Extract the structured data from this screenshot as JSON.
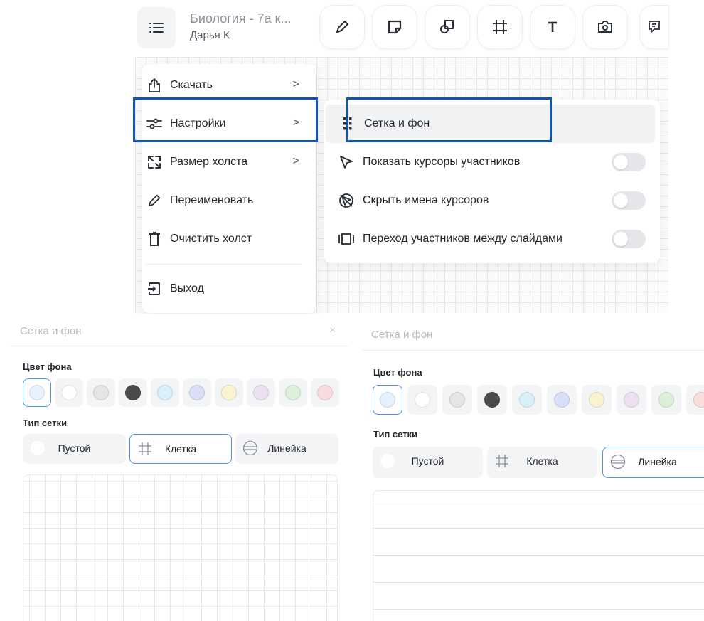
{
  "toolbar": {
    "board_title": "Биология - 7а к...",
    "board_owner": "Дарья К",
    "tools": [
      "pencil-icon",
      "sticky-note-icon",
      "shapes-icon",
      "frame-icon",
      "text-icon",
      "camera-icon",
      "comment-icon"
    ]
  },
  "main_menu": {
    "items": [
      {
        "label": "Скачать",
        "icon": "upload-icon",
        "submenu": true
      },
      {
        "label": "Настройки",
        "icon": "sliders-icon",
        "submenu": true
      },
      {
        "label": "Размер холста",
        "icon": "resize-icon",
        "submenu": true
      },
      {
        "label": "Переименовать",
        "icon": "pencil-icon",
        "submenu": false
      },
      {
        "label": "Очистить холст",
        "icon": "trash-icon",
        "submenu": false
      },
      {
        "label": "Выход",
        "icon": "exit-icon",
        "submenu": false
      }
    ],
    "chevron": ">"
  },
  "settings_submenu": {
    "items": [
      {
        "label": "Сетка и фон",
        "icon": "grid-dots-icon",
        "toggle": null
      },
      {
        "label": "Показать курсоры участников",
        "icon": "cursor-icon",
        "toggle": false
      },
      {
        "label": "Скрыть имена курсоров",
        "icon": "hide-names-icon",
        "toggle": false
      },
      {
        "label": "Переход участников между слайдами",
        "icon": "slides-icon",
        "toggle": false
      }
    ]
  },
  "grid_panel_left": {
    "title": "Сетка и фон",
    "close": "×",
    "bg_color_label": "Цвет фона",
    "grid_type_label": "Тип сетки",
    "selected_color_index": 0,
    "selected_grid": "Клетка",
    "grid_options": [
      "Пустой",
      "Клетка",
      "Линейка"
    ]
  },
  "grid_panel_right": {
    "title": "Сетка и фон",
    "bg_color_label": "Цвет фона",
    "grid_type_label": "Тип сетки",
    "selected_color_index": 0,
    "selected_grid": "Линейка",
    "grid_options": [
      "Пустой",
      "Клетка",
      "Линейка"
    ]
  },
  "colors": {
    "swatches": [
      "#e7f0fd",
      "#ffffff",
      "#e4e5e7",
      "#4a4a4c",
      "#d9f0fb",
      "#dadff9",
      "#fbf2cf",
      "#ede0f1",
      "#dcf0d9",
      "#fadcdc"
    ],
    "highlight": "#1352b8",
    "selection": "#4a90f0"
  }
}
